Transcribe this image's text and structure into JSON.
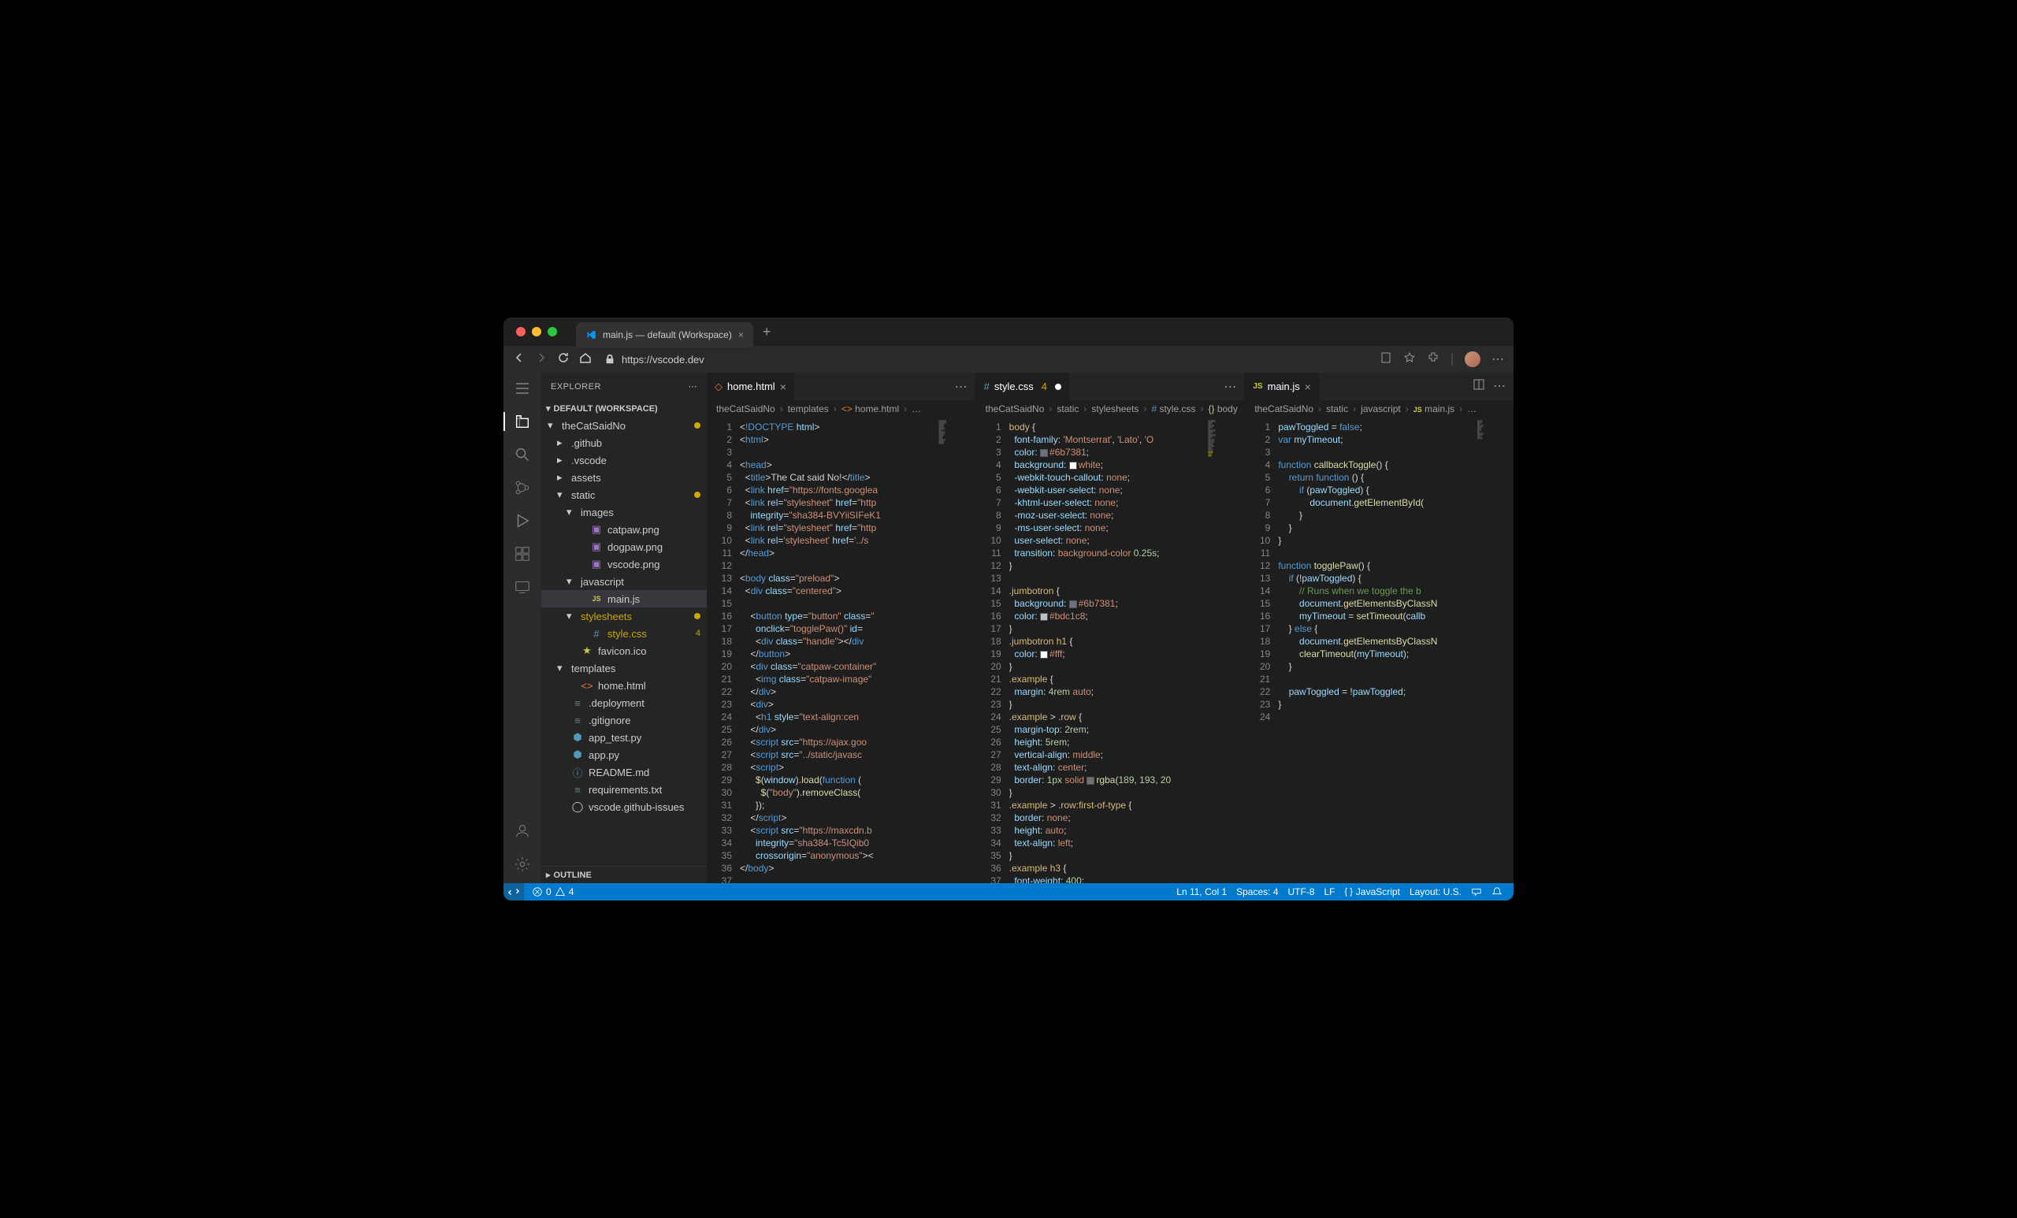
{
  "window": {
    "tab_title": "main.js — default (Workspace)",
    "url": "https://vscode.dev"
  },
  "sidebar": {
    "title": "EXPLORER",
    "workspace": "DEFAULT (WORKSPACE)",
    "outline": "OUTLINE",
    "tree": [
      {
        "depth": 0,
        "type": "folder",
        "open": true,
        "label": "theCatSaidNo",
        "git": true
      },
      {
        "depth": 1,
        "type": "folder",
        "open": false,
        "label": ".github"
      },
      {
        "depth": 1,
        "type": "folder",
        "open": false,
        "label": ".vscode"
      },
      {
        "depth": 1,
        "type": "folder",
        "open": false,
        "label": "assets"
      },
      {
        "depth": 1,
        "type": "folder",
        "open": true,
        "label": "static",
        "git": true
      },
      {
        "depth": 2,
        "type": "folder",
        "open": true,
        "label": "images"
      },
      {
        "depth": 3,
        "type": "file",
        "icon": "img",
        "label": "catpaw.png"
      },
      {
        "depth": 3,
        "type": "file",
        "icon": "img",
        "label": "dogpaw.png"
      },
      {
        "depth": 3,
        "type": "file",
        "icon": "img",
        "label": "vscode.png"
      },
      {
        "depth": 2,
        "type": "folder",
        "open": true,
        "label": "javascript"
      },
      {
        "depth": 3,
        "type": "file",
        "icon": "js",
        "label": "main.js",
        "active": true
      },
      {
        "depth": 2,
        "type": "folder",
        "open": true,
        "label": "stylesheets",
        "git": true,
        "gitclass": "git-mod"
      },
      {
        "depth": 3,
        "type": "file",
        "icon": "css",
        "label": "style.css",
        "badge": "4",
        "gitclass": "git-mod"
      },
      {
        "depth": 2,
        "type": "file",
        "icon": "fav",
        "label": "favicon.ico"
      },
      {
        "depth": 1,
        "type": "folder",
        "open": true,
        "label": "templates"
      },
      {
        "depth": 2,
        "type": "file",
        "icon": "html",
        "label": "home.html"
      },
      {
        "depth": 1,
        "type": "file",
        "icon": "txt",
        "label": ".deployment"
      },
      {
        "depth": 1,
        "type": "file",
        "icon": "txt",
        "label": ".gitignore"
      },
      {
        "depth": 1,
        "type": "file",
        "icon": "py",
        "label": "app_test.py"
      },
      {
        "depth": 1,
        "type": "file",
        "icon": "py",
        "label": "app.py"
      },
      {
        "depth": 1,
        "type": "file",
        "icon": "md",
        "label": "README.md"
      },
      {
        "depth": 1,
        "type": "file",
        "icon": "txt",
        "label": "requirements.txt"
      },
      {
        "depth": 1,
        "type": "file",
        "icon": "gh",
        "label": "vscode.github-issues"
      }
    ]
  },
  "panes": [
    {
      "tab": {
        "icon": "html",
        "label": "home.html"
      },
      "breadcrumb": [
        "theCatSaidNo",
        "templates",
        "home.html",
        "…"
      ],
      "bc_icon": "html"
    },
    {
      "tab": {
        "icon": "css",
        "label": "style.css",
        "badge": "4",
        "dirty": true
      },
      "breadcrumb": [
        "theCatSaidNo",
        "static",
        "stylesheets",
        "style.css",
        "body"
      ],
      "bc_icon": "css"
    },
    {
      "tab": {
        "icon": "js",
        "label": "main.js"
      },
      "breadcrumb": [
        "theCatSaidNo",
        "static",
        "javascript",
        "main.js",
        "…"
      ],
      "bc_icon": "js",
      "has_split": true
    }
  ],
  "status": {
    "errors": "0",
    "warnings": "4",
    "cursor": "Ln 11, Col 1",
    "spaces": "Spaces: 4",
    "encoding": "UTF-8",
    "eol": "LF",
    "lang": "JavaScript",
    "layout": "Layout: U.S."
  }
}
